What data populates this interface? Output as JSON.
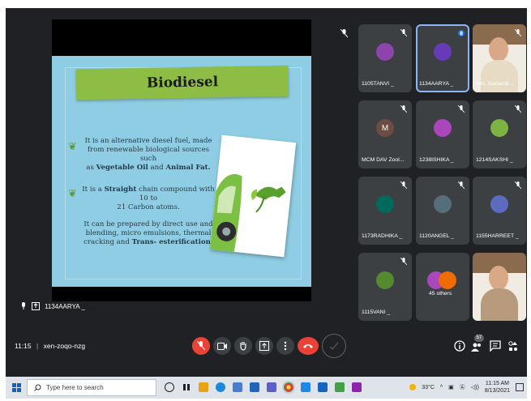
{
  "slide": {
    "title": "Biodiesel",
    "b1_line1": "It is an alternative diesel fuel, made",
    "b1_line2": "from renewable biological sources such",
    "b1_pre": "as ",
    "b1_bold1": "Vegetable Oil",
    "b1_mid": " and ",
    "b1_bold2": "Animal Fat.",
    "b2_pre": "It is a ",
    "b2_bold": "Straight",
    "b2_post": " chain compound with 10 to",
    "b2_line2": "21 Carbon atoms.",
    "b3_line1": "It can be prepared by direct use and",
    "b3_line2": "blending, micro emulsions, thermal",
    "b3_pre": "cracking and ",
    "b3_bold": "Trans- esterification."
  },
  "presenter": {
    "name": "1134AARYA _"
  },
  "tiles": [
    {
      "name": "1105TANVI _",
      "initial": "",
      "color": "#8e44ad"
    },
    {
      "name": "1134AARYA _",
      "initial": "",
      "color": "#673ab7"
    },
    {
      "name": "Mrs. Kadamb...",
      "initial": "",
      "color": "#d8d8d8"
    },
    {
      "name": "MCM DAV Zool...",
      "initial": "M",
      "color": "#6d4c41"
    },
    {
      "name": "1238ISHIKA _",
      "initial": "",
      "color": "#ab47bc"
    },
    {
      "name": "1214SAKSHI _",
      "initial": "",
      "color": "#7cb342"
    },
    {
      "name": "1173RADHIKA _",
      "initial": "",
      "color": "#00695c"
    },
    {
      "name": "1120ANGEL _",
      "initial": "",
      "color": "#546e7a"
    },
    {
      "name": "1155HARREET _",
      "initial": "",
      "color": "#5c6bc0"
    },
    {
      "name": "1115VANI _",
      "initial": "",
      "color": "#558b2f"
    },
    {
      "name": "45 others",
      "initial": "",
      "color": "#ab47bc"
    },
    {
      "name": "",
      "initial": "",
      "color": "#c9b9a8"
    }
  ],
  "meeting": {
    "time": "11:15",
    "separator": "|",
    "code": "xen-zoqo-nzg",
    "people_count": "57"
  },
  "taskbar": {
    "search_placeholder": "Type here to search",
    "weather": "33°C",
    "time": "11:15 AM",
    "date": "8/13/2021"
  },
  "colors": {
    "background": "#202124",
    "tile": "#3c4043",
    "end_call": "#ea4335",
    "slide_bg": "#8ecde3",
    "banner": "#8dbd45"
  }
}
